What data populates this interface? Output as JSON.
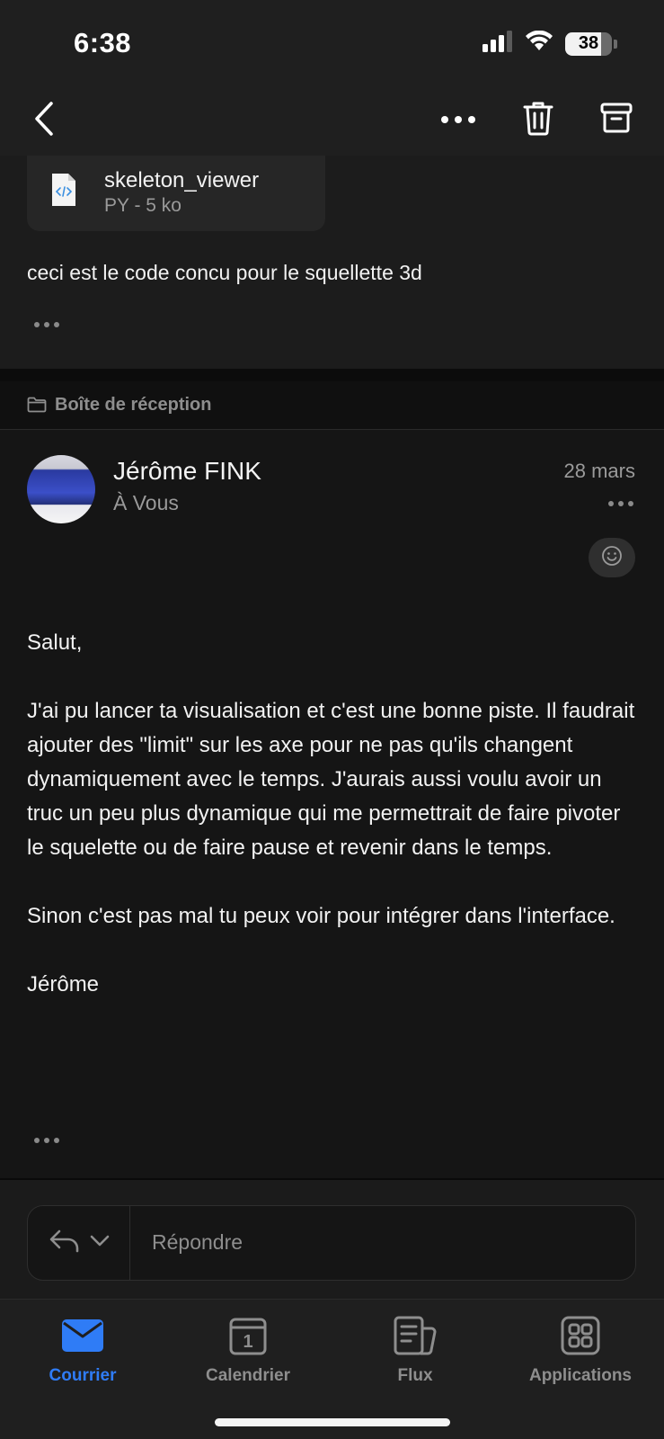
{
  "status_bar": {
    "time": "6:38",
    "battery_level": "38",
    "icons": [
      "signal-icon",
      "wifi-icon",
      "battery-icon"
    ]
  },
  "nav": {
    "icons": [
      "back-chevron-icon",
      "more-horizontal-icon",
      "trash-icon",
      "archive-icon"
    ]
  },
  "previous_message": {
    "attachment": {
      "name": "skeleton_viewer",
      "meta": "PY - 5 ko",
      "icon": "code-file-icon"
    },
    "body": "ceci est le code concu pour le squellette 3d"
  },
  "folder": {
    "icon": "folder-icon",
    "label": "Boîte de réception"
  },
  "message": {
    "sender": "Jérôme FINK",
    "recipient": "À Vous",
    "date": "28 mars",
    "body": "Salut,\n\nJ'ai pu lancer ta visualisation et c'est une bonne piste. Il faudrait ajouter des \"limit\" sur les axe pour ne pas qu'ils changent dynamiquement avec le temps. J'aurais aussi voulu avoir un truc un peu plus dynamique qui me permettrait de faire pivoter le squelette ou de faire pause et revenir dans le temps.\n\nSinon c'est pas mal tu peux voir pour intégrer dans l'interface.\n\nJérôme"
  },
  "reply": {
    "label": "Répondre",
    "icons": [
      "reply-icon",
      "chevron-down-icon"
    ]
  },
  "tabs": [
    {
      "label": "Courrier",
      "icon": "mail-icon",
      "active": true
    },
    {
      "label": "Calendrier",
      "icon": "calendar-icon",
      "active": false
    },
    {
      "label": "Flux",
      "icon": "feed-icon",
      "active": false
    },
    {
      "label": "Applications",
      "icon": "apps-grid-icon",
      "active": false
    }
  ],
  "calendar_day": "1",
  "colors": {
    "background": "#151515",
    "accent": "#2f7cf6",
    "muted_text": "#9a9a9a"
  }
}
